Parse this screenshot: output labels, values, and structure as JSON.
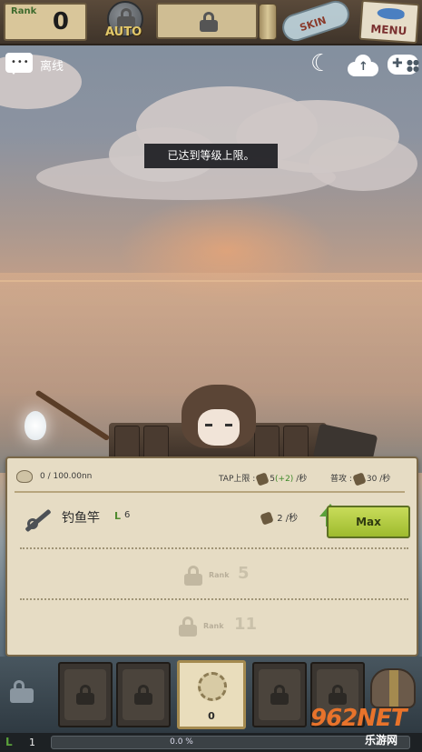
{
  "topbar": {
    "rank_label": "Rank",
    "rank_value": "0",
    "auto_label": "AUTO",
    "skin_label": "SKIN",
    "menu_label": "MENU"
  },
  "status": {
    "offline_label": "离线"
  },
  "toast": {
    "message": "已达到等级上限。"
  },
  "panel": {
    "currency_text": "0 / 100.00nn",
    "tap_limit_label": "TAP上限 :",
    "tap_limit_value": "5",
    "tap_limit_bonus": "(+2)",
    "tap_limit_unit": "/秒",
    "attack_label": "普攻 :",
    "attack_value": "30",
    "attack_unit": "/秒",
    "rod": {
      "name": "钓鱼竿",
      "level": "6",
      "rate_value": "2",
      "rate_unit": "/秒",
      "max_label": "Max"
    },
    "locked_rows": [
      {
        "rank_label": "Rank",
        "rank_num": "5"
      },
      {
        "rank_label": "Rank",
        "rank_num": "11"
      }
    ]
  },
  "slots": {
    "active_count": "0"
  },
  "xp": {
    "level": "1",
    "percent_text": "0.0 %",
    "progress": 0.0
  },
  "watermark": {
    "main": "962NET",
    "sub": "乐游网"
  },
  "colors": {
    "max_button": "#9ebb2e",
    "panel_bg": "#e6dcc4",
    "accent_green": "#5aa13b",
    "xp_fill": "#6da6d8"
  }
}
